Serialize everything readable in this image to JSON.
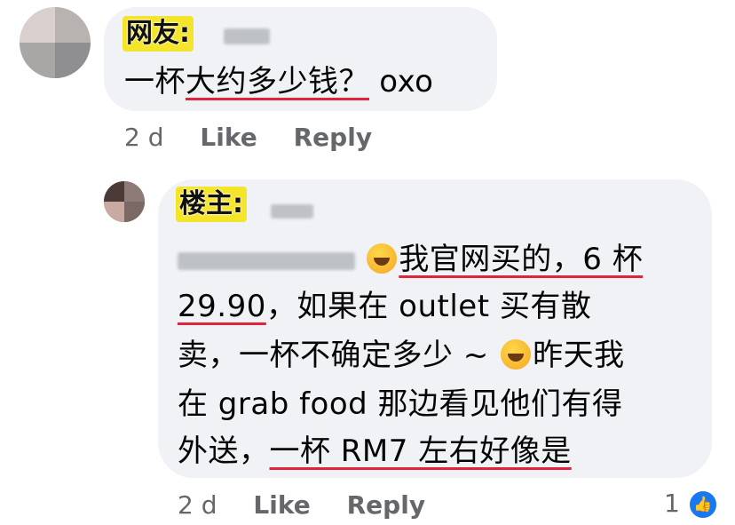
{
  "comment1": {
    "tag": "网友:",
    "text_a": "一杯",
    "text_b": "大约多少钱？",
    "text_c": " oxo",
    "time": "2 d",
    "like": "Like",
    "reply": "Reply"
  },
  "comment2": {
    "tag": "楼主:",
    "line1_a": "我官网买的，6 杯",
    "line2_a": "29.90",
    "line2_b": "，如果在 outlet 买有散",
    "line3_a": "卖，一杯不确定多少 ~ ",
    "line3_b": "昨天我",
    "line4": "在 grab food 那边看见他们有得",
    "line5_a": "外送，",
    "line5_b": "一杯 RM7 左右好像是",
    "time": "2 d",
    "like": "Like",
    "reply": "Reply",
    "reaction_count": "1",
    "reaction_icon": "thumbs-up-icon"
  },
  "colors": {
    "bubble": "#f0f2f5",
    "underline": "#e0243c",
    "tag_bg": "#f5e52a",
    "meta": "#65676b",
    "like_badge": "#1877f2"
  }
}
